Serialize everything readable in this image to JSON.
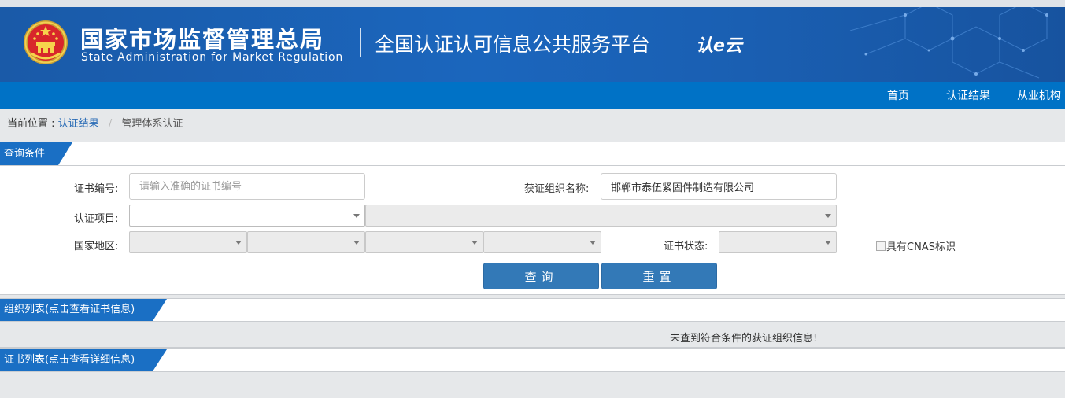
{
  "header": {
    "agency_cn": "国家市场监督管理总局",
    "agency_en": "State Administration  for  Market Regulation",
    "platform": "全国认证认可信息公共服务平台",
    "platform_logo": "认e云"
  },
  "nav": {
    "items": [
      {
        "label": "首页"
      },
      {
        "label": "认证结果"
      },
      {
        "label": "从业机构"
      }
    ]
  },
  "breadcrumb": {
    "prefix": "当前位置 :",
    "link": "认证结果",
    "separator": "/",
    "current": "管理体系认证"
  },
  "query": {
    "section_title": "查询条件",
    "cert_no": {
      "label": "证书编号:",
      "placeholder": "请输入准确的证书编号",
      "value": ""
    },
    "org_name": {
      "label": "获证组织名称:",
      "value": "邯郸市泰伍紧固件制造有限公司"
    },
    "cert_item": {
      "label": "认证项目:"
    },
    "region": {
      "label": "国家地区:"
    },
    "cert_status": {
      "label": "证书状态:"
    },
    "cnas": {
      "label": "具有CNAS标识"
    },
    "search_button": "查询",
    "reset_button": "重置"
  },
  "org_list": {
    "title": "组织列表(点击查看证书信息)",
    "empty_message": "未查到符合条件的获证组织信息!"
  },
  "cert_list": {
    "title": "证书列表(点击查看详细信息)"
  },
  "colors": {
    "banner": "#1b66bd",
    "nav": "#0072c6",
    "tab": "#1a6fc4",
    "button": "#3379b7",
    "link": "#2a6cb6"
  }
}
